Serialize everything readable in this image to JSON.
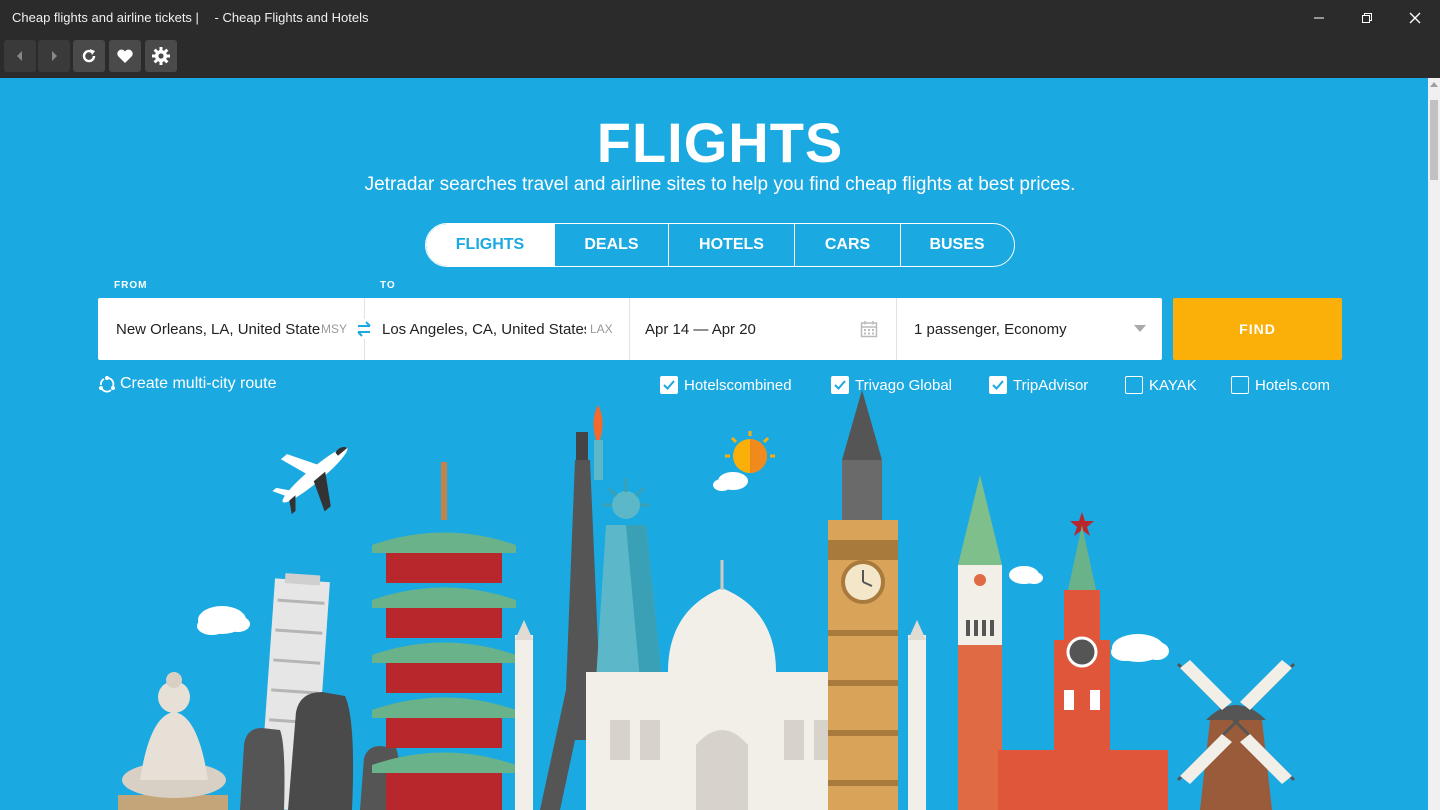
{
  "window": {
    "title_left": "Cheap flights and airline tickets |",
    "title_right": "- Cheap Flights and Hotels",
    "controls": [
      "minimize-icon",
      "restore-icon",
      "close-icon"
    ]
  },
  "toolbar": {
    "buttons": [
      "back-icon",
      "forward-icon",
      "refresh-icon",
      "favorite-icon",
      "settings-icon"
    ]
  },
  "hero": {
    "title": "FLIGHTS",
    "subtitle": "Jetradar searches travel and airline sites to help you find cheap flights at best prices."
  },
  "tabs": [
    {
      "label": "FLIGHTS",
      "active": true
    },
    {
      "label": "DEALS",
      "active": false
    },
    {
      "label": "HOTELS",
      "active": false
    },
    {
      "label": "CARS",
      "active": false
    },
    {
      "label": "BUSES",
      "active": false
    }
  ],
  "search": {
    "from_label": "FROM",
    "to_label": "TO",
    "from_value": "New Orleans, LA, United States",
    "from_code": "MSY",
    "to_value": "Los Angeles, CA, United States",
    "to_code": "LAX",
    "dates": "Apr 14 — Apr 20",
    "passengers": "1 passenger, Economy",
    "find_label": "FIND"
  },
  "multi_city": "Create multi-city route",
  "partners": [
    {
      "label": "Hotelscombined",
      "checked": true
    },
    {
      "label": "Trivago Global",
      "checked": true
    },
    {
      "label": "TripAdvisor",
      "checked": true
    },
    {
      "label": "KAYAK",
      "checked": false
    },
    {
      "label": "Hotels.com",
      "checked": false
    }
  ],
  "colors": {
    "background": "#1aa9e1",
    "accent_find": "#fbb009",
    "chrome": "#2b2b2b"
  }
}
